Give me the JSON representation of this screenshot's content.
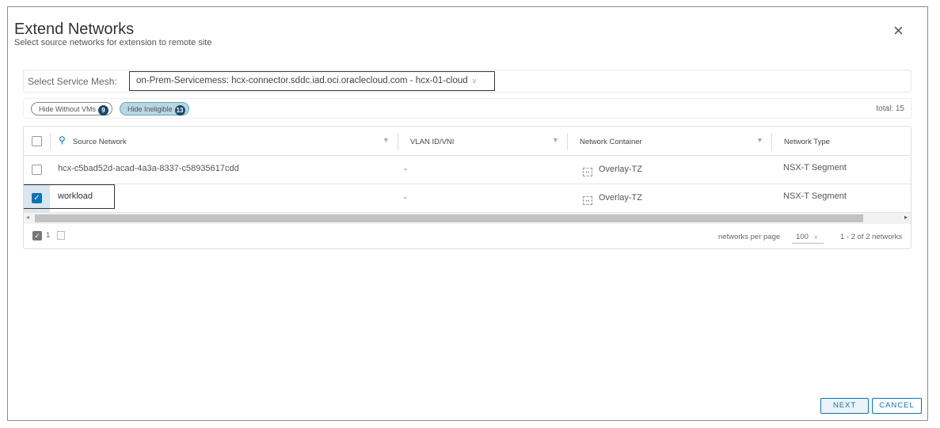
{
  "dialog": {
    "title": "Extend Networks",
    "subtitle": "Select source networks for extension to remote site",
    "close_icon": "×"
  },
  "mesh": {
    "label": "Select Service Mesh:",
    "value": "on-Prem-Servicemess:   hcx-connector.sddc.iad.oci.oraclecloud.com - hcx-01-cloud"
  },
  "filters": [
    {
      "label": "Hide Without VMs",
      "count": "9",
      "active": false
    },
    {
      "label": "Hide Ineligible",
      "count": "13",
      "active": true
    }
  ],
  "total": "total: 15",
  "table": {
    "columns": [
      "Source Network",
      "VLAN ID/VNI",
      "Network Container",
      "Network Type"
    ],
    "rows": [
      {
        "source": "hcx-c5bad52d-acad-4a3a-8337-c58935617cdd",
        "vlan": "-",
        "container": "Overlay-TZ",
        "type": "NSX-T Segment",
        "checked": false
      },
      {
        "source": "workload",
        "vlan": "-",
        "container": "Overlay-TZ",
        "type": "NSX-T Segment",
        "checked": true
      }
    ]
  },
  "footer": {
    "selected_count": "1",
    "per_page_label": "networks per page",
    "per_page": "100",
    "range": "1 - 2 of 2 networks"
  },
  "buttons": {
    "next": "NEXT",
    "cancel": "CANCEL"
  }
}
